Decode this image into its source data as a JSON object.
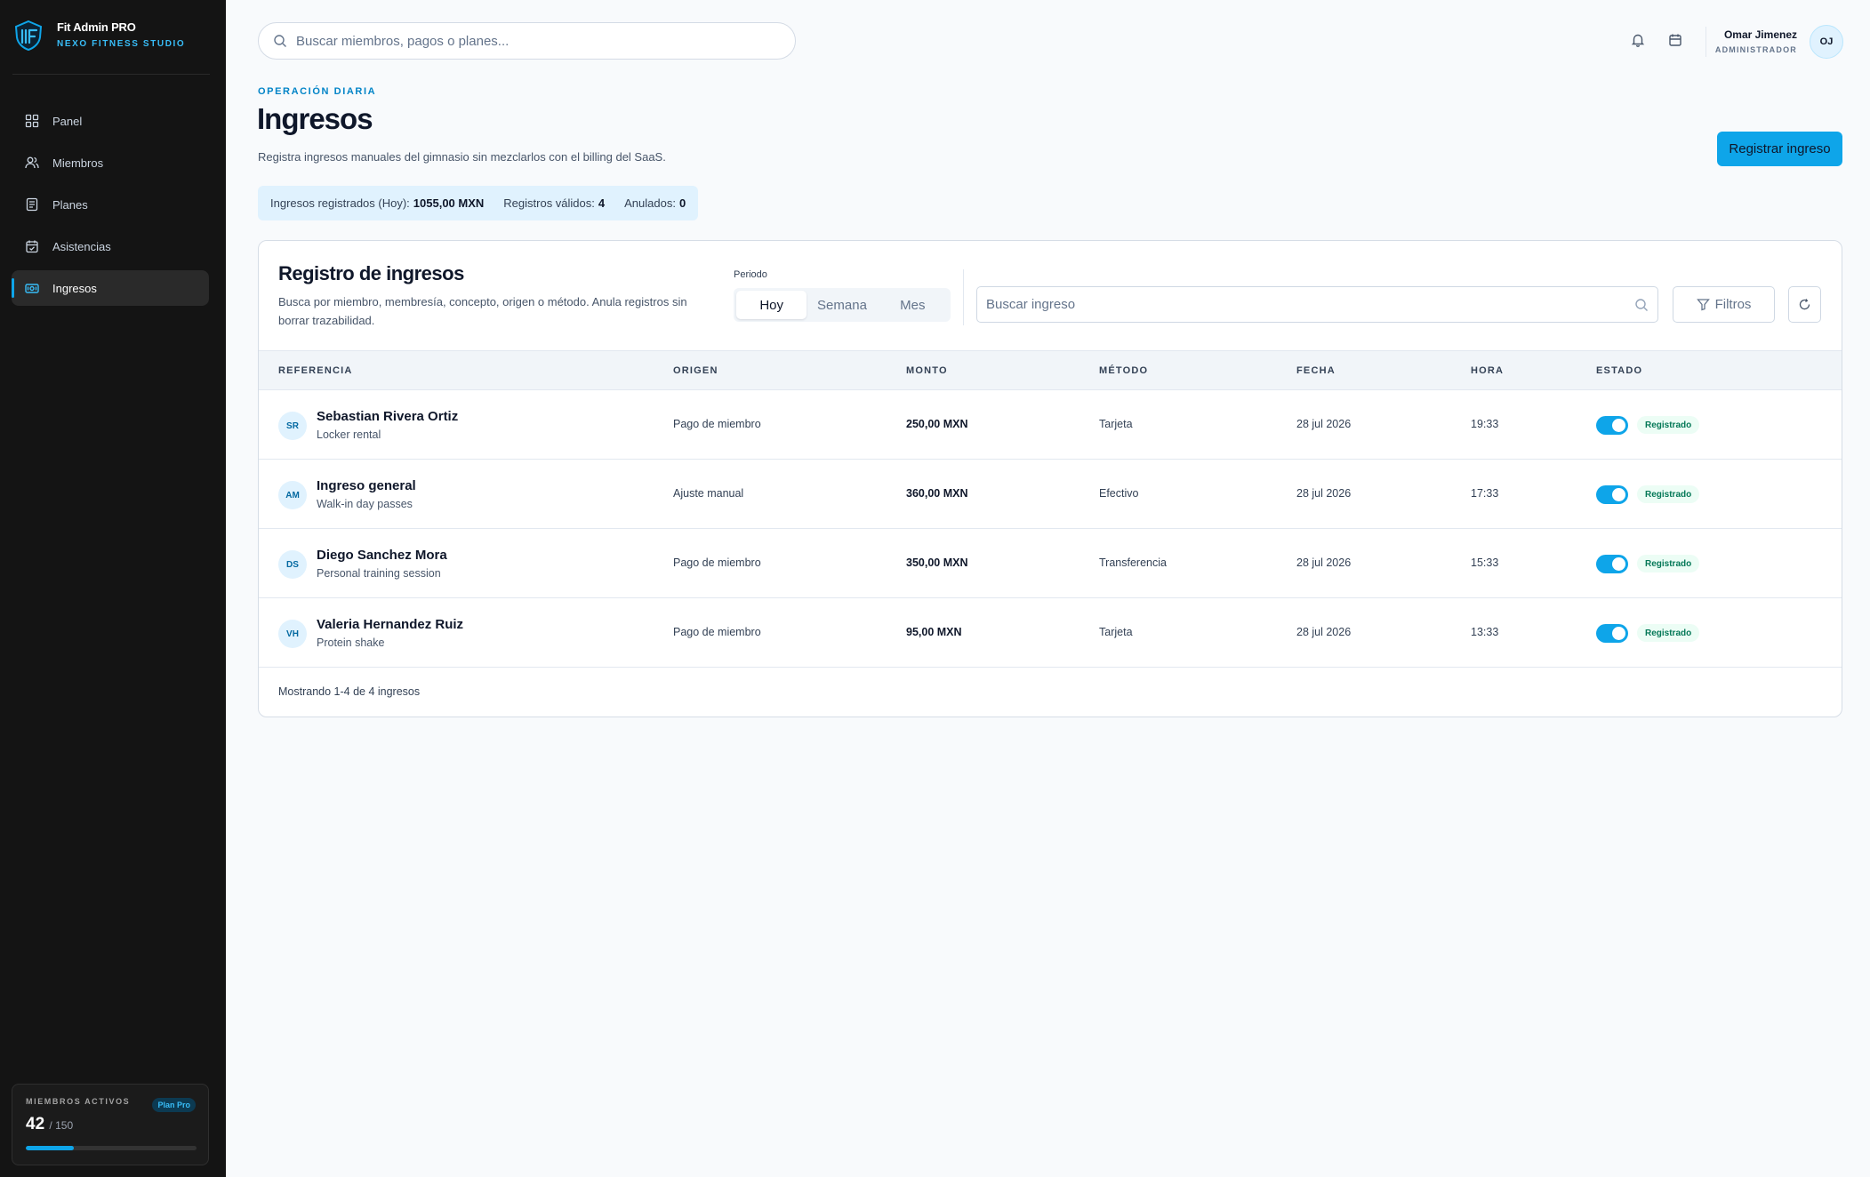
{
  "brand": {
    "name": "Fit Admin PRO",
    "studio": "NEXO FITNESS STUDIO"
  },
  "sidebar": {
    "items": [
      {
        "label": "Panel",
        "icon": "grid-icon"
      },
      {
        "label": "Miembros",
        "icon": "users-icon"
      },
      {
        "label": "Planes",
        "icon": "document-icon"
      },
      {
        "label": "Asistencias",
        "icon": "calendar-check-icon"
      },
      {
        "label": "Ingresos",
        "icon": "money-icon",
        "active": true
      }
    ],
    "members_card": {
      "label": "MIEMBROS ACTIVOS",
      "badge": "Plan Pro",
      "count": "42",
      "total": "/ 150",
      "fill_fraction": 0.28
    }
  },
  "header": {
    "search_placeholder": "Buscar miembros, pagos o planes...",
    "user_name": "Omar Jimenez",
    "user_role": "ADMINISTRADOR",
    "user_initials": "OJ"
  },
  "page": {
    "eyebrow": "OPERACIÓN DIARIA",
    "title": "Ingresos",
    "description": "Registra ingresos manuales del gimnasio sin mezclarlos con el billing del SaaS.",
    "primary_action": "Registrar ingreso"
  },
  "stats": {
    "registered_label": "Ingresos registrados (Hoy):",
    "registered_value": "1055,00 MXN",
    "valid_label": "Registros válidos:",
    "valid_value": "4",
    "voided_label": "Anulados:",
    "voided_value": "0"
  },
  "card": {
    "title": "Registro de ingresos",
    "description": "Busca por miembro, membresía, concepto, origen o método. Anula registros sin borrar trazabilidad.",
    "period_label": "Periodo",
    "periods": [
      "Hoy",
      "Semana",
      "Mes"
    ],
    "active_period": "Hoy",
    "search_placeholder": "Buscar ingreso",
    "filters_label": "Filtros",
    "columns": [
      "REFERENCIA",
      "ORIGEN",
      "MONTO",
      "MÉTODO",
      "FECHA",
      "HORA",
      "ESTADO"
    ],
    "rows": [
      {
        "initials": "SR",
        "name": "Sebastian Rivera Ortiz",
        "concept": "Locker rental",
        "origin": "Pago de miembro",
        "amount": "250,00 MXN",
        "method": "Tarjeta",
        "date": "28 jul 2026",
        "time": "19:33",
        "status": "Registrado"
      },
      {
        "initials": "AM",
        "name": "Ingreso general",
        "concept": "Walk-in day passes",
        "origin": "Ajuste manual",
        "amount": "360,00 MXN",
        "method": "Efectivo",
        "date": "28 jul 2026",
        "time": "17:33",
        "status": "Registrado"
      },
      {
        "initials": "DS",
        "name": "Diego Sanchez Mora",
        "concept": "Personal training session",
        "origin": "Pago de miembro",
        "amount": "350,00 MXN",
        "method": "Transferencia",
        "date": "28 jul 2026",
        "time": "15:33",
        "status": "Registrado"
      },
      {
        "initials": "VH",
        "name": "Valeria Hernandez Ruiz",
        "concept": "Protein shake",
        "origin": "Pago de miembro",
        "amount": "95,00 MXN",
        "method": "Tarjeta",
        "date": "28 jul 2026",
        "time": "13:33",
        "status": "Registrado"
      }
    ],
    "footer": "Mostrando 1-4 de 4 ingresos"
  },
  "colors": {
    "accent": "#0ea5e9",
    "sidebar_bg": "#141414",
    "success": "#047857"
  }
}
